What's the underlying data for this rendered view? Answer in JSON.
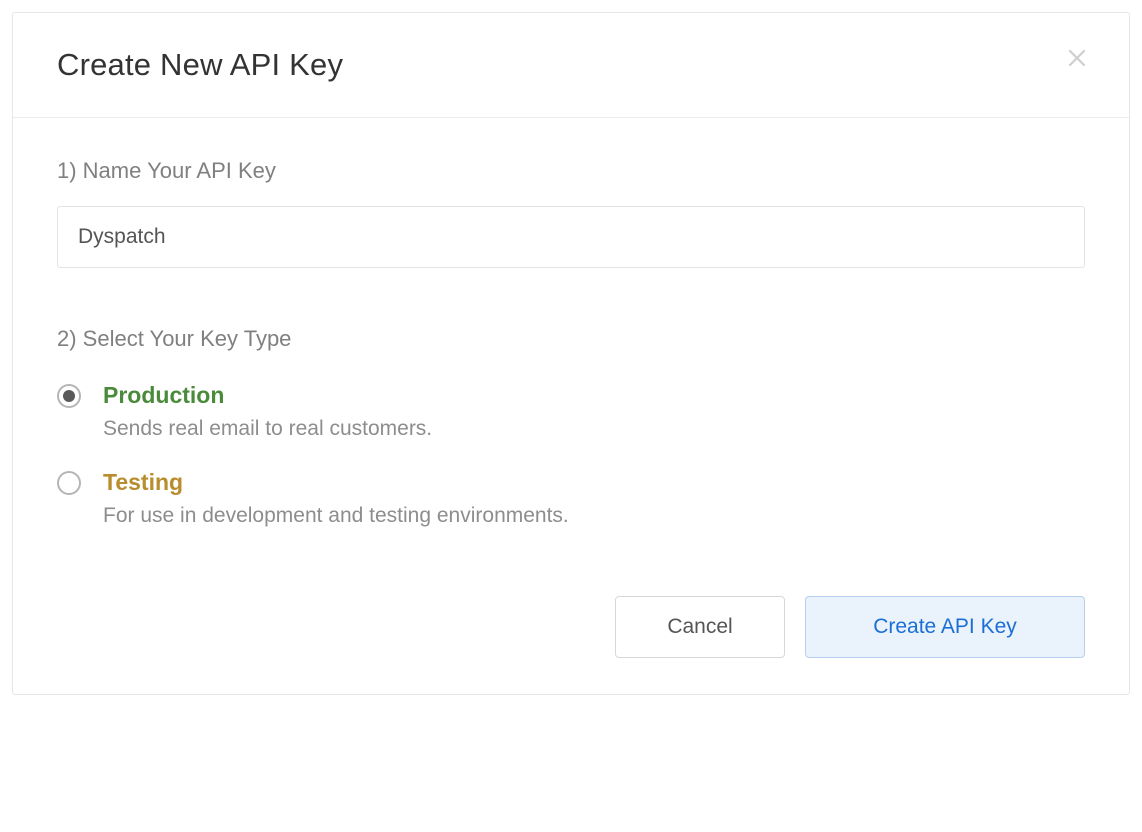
{
  "modal": {
    "title": "Create New API Key",
    "step1_label": "1) Name Your API Key",
    "name_value": "Dyspatch",
    "step2_label": "2) Select Your Key Type",
    "options": [
      {
        "id": "production",
        "title": "Production",
        "description": "Sends real email to real customers.",
        "selected": true,
        "color": "#4a8b3b"
      },
      {
        "id": "testing",
        "title": "Testing",
        "description": "For use in development and testing environments.",
        "selected": false,
        "color": "#b88d2e"
      }
    ],
    "buttons": {
      "cancel": "Cancel",
      "create": "Create API Key"
    }
  }
}
